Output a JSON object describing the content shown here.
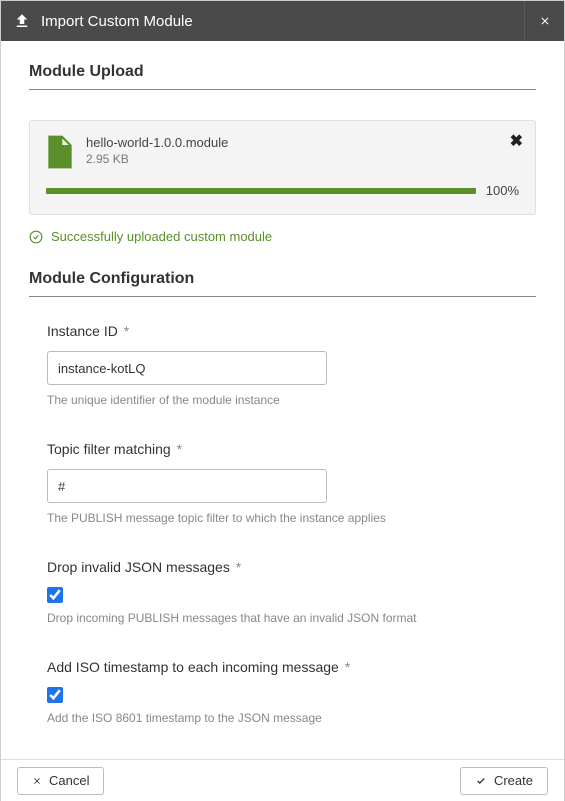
{
  "header": {
    "title": "Import Custom Module"
  },
  "upload": {
    "section_title": "Module Upload",
    "file_name": "hello-world-1.0.0.module",
    "file_size": "2.95 KB",
    "progress_pct": "100%",
    "success_msg": "Successfully uploaded custom module"
  },
  "config": {
    "section_title": "Module Configuration",
    "instance_id": {
      "label": "Instance ID",
      "value": "instance-kotLQ",
      "help": "The unique identifier of the module instance"
    },
    "topic_filter": {
      "label": "Topic filter matching",
      "value": "#",
      "help": "The PUBLISH message topic filter to which the instance applies"
    },
    "drop_invalid": {
      "label": "Drop invalid JSON messages",
      "help": "Drop incoming PUBLISH messages that have an invalid JSON format"
    },
    "add_iso": {
      "label": "Add ISO timestamp to each incoming message",
      "help": "Add the ISO 8601 timestamp to the JSON message"
    }
  },
  "footer": {
    "cancel": "Cancel",
    "create": "Create"
  }
}
